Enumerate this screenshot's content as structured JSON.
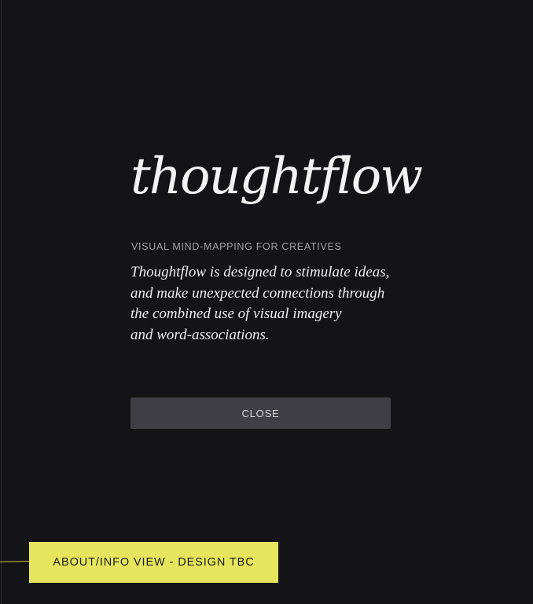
{
  "about": {
    "logo_text": "thoughtflow",
    "tagline": "VISUAL MIND-MAPPING FOR CREATIVES",
    "description_lines": [
      "Thoughtflow is designed to stimulate ideas,",
      "and make unexpected connections through",
      "the combined use of visual imagery",
      "and word-associations."
    ],
    "close_label": "CLOSE"
  },
  "annotation": {
    "note_label": "ABOUT/INFO VIEW - DESIGN TBC"
  },
  "colors": {
    "background": "#141416",
    "button": "#3f3f45",
    "note": "#e6e55d"
  }
}
